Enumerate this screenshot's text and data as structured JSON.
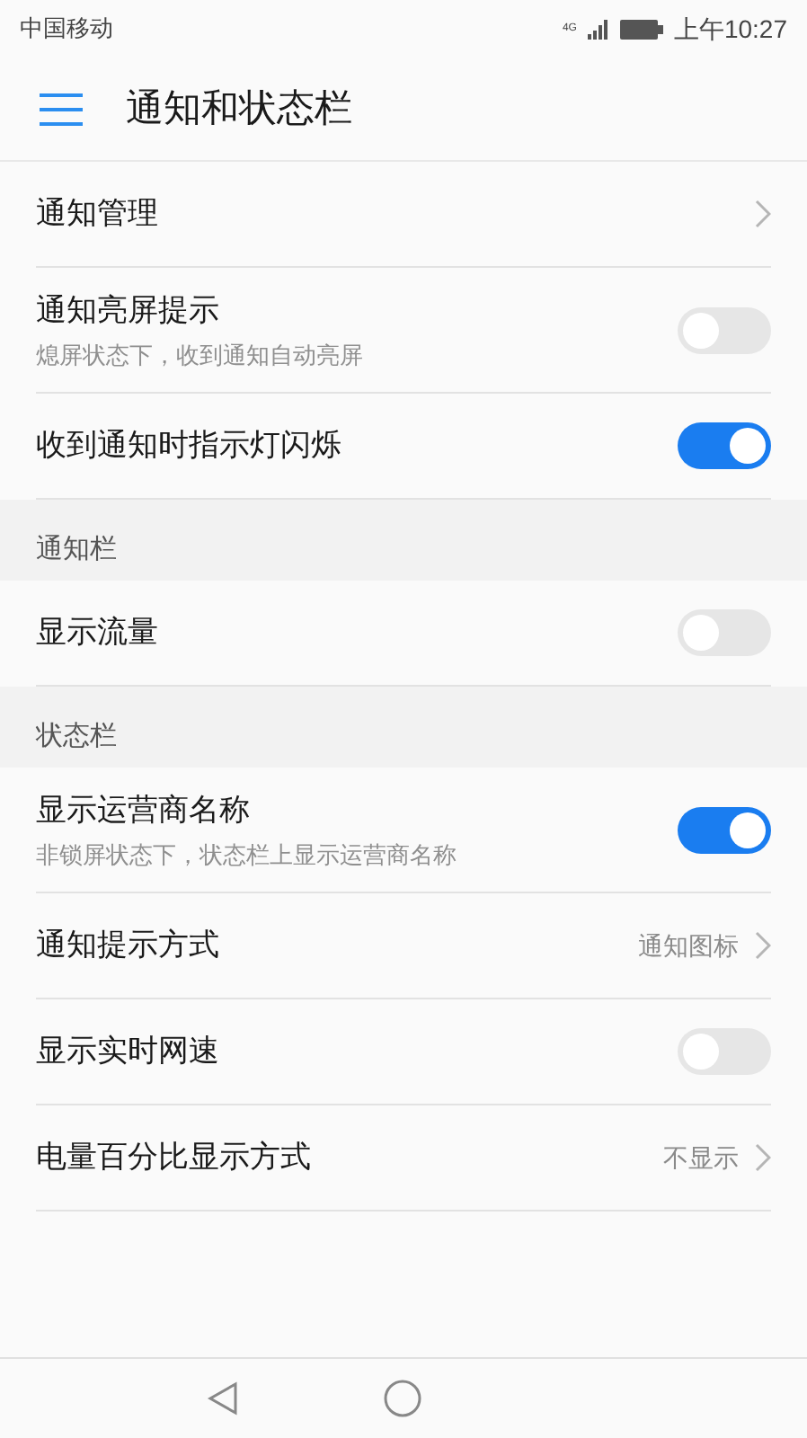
{
  "status_bar": {
    "carrier": "中国移动",
    "network": "4G",
    "time": "上午10:27"
  },
  "app_bar": {
    "title": "通知和状态栏"
  },
  "items": [
    {
      "kind": "link",
      "label": "通知管理"
    },
    {
      "kind": "toggle",
      "label": "通知亮屏提示",
      "summary": "熄屏状态下，收到通知自动亮屏",
      "on": false
    },
    {
      "kind": "toggle",
      "label": "收到通知时指示灯闪烁",
      "on": true
    },
    {
      "kind": "header",
      "label": "通知栏"
    },
    {
      "kind": "toggle",
      "label": "显示流量",
      "on": false
    },
    {
      "kind": "header",
      "label": "状态栏"
    },
    {
      "kind": "toggle",
      "label": "显示运营商名称",
      "summary": "非锁屏状态下，状态栏上显示运营商名称",
      "on": true
    },
    {
      "kind": "link",
      "label": "通知提示方式",
      "value": "通知图标"
    },
    {
      "kind": "toggle",
      "label": "显示实时网速",
      "on": false
    },
    {
      "kind": "link",
      "label": "电量百分比显示方式",
      "value": "不显示"
    }
  ]
}
